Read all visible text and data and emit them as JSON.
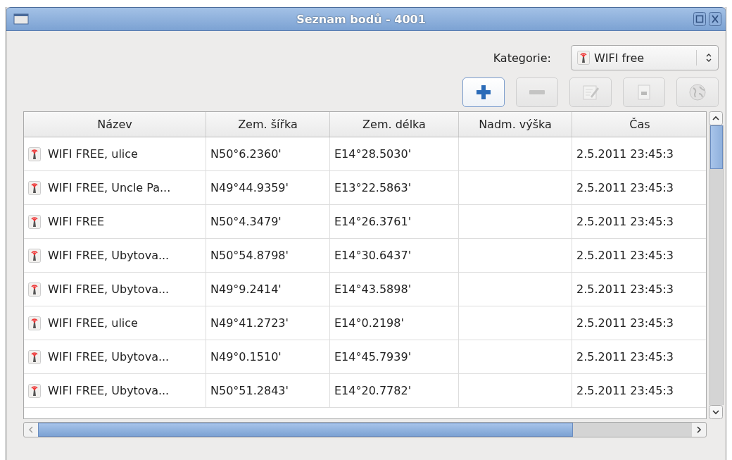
{
  "window": {
    "title": "Seznam bodů - 4001"
  },
  "category": {
    "label": "Kategorie:",
    "value": "WIFI free"
  },
  "toolbar": [
    {
      "kind": "add",
      "disabled": false
    },
    {
      "kind": "remove",
      "disabled": true
    },
    {
      "kind": "edit",
      "disabled": true
    },
    {
      "kind": "document",
      "disabled": true
    },
    {
      "kind": "globe",
      "disabled": true
    }
  ],
  "table": {
    "columns": [
      "Název",
      "Zem. šířka",
      "Zem. délka",
      "Nadm. výška",
      "Čas"
    ],
    "rows": [
      {
        "name": "WIFI FREE, ulice",
        "lat": "N50°6.2360'",
        "lon": "E14°28.5030'",
        "time": "2.5.2011 23:45:3"
      },
      {
        "name": "WIFI FREE, Uncle Pa...",
        "lat": "N49°44.9359'",
        "lon": "E13°22.5863'",
        "time": "2.5.2011 23:45:3"
      },
      {
        "name": "WIFI FREE",
        "lat": "N50°4.3479'",
        "lon": "E14°26.3761'",
        "time": "2.5.2011 23:45:3"
      },
      {
        "name": "WIFI FREE, Ubytova...",
        "lat": "N50°54.8798'",
        "lon": "E14°30.6437'",
        "time": "2.5.2011 23:45:3"
      },
      {
        "name": "WIFI FREE, Ubytova...",
        "lat": "N49°9.2414'",
        "lon": "E14°43.5898'",
        "time": "2.5.2011 23:45:3"
      },
      {
        "name": "WIFI FREE, ulice",
        "lat": "N49°41.2723'",
        "lon": "E14°0.2198'",
        "time": "2.5.2011 23:45:3"
      },
      {
        "name": "WIFI FREE, Ubytova...",
        "lat": "N49°0.1510'",
        "lon": "E14°45.7939'",
        "time": "2.5.2011 23:45:3"
      },
      {
        "name": "WIFI FREE, Ubytova...",
        "lat": "N50°51.2843'",
        "lon": "E14°20.7782'",
        "time": "2.5.2011 23:45:3"
      }
    ]
  }
}
